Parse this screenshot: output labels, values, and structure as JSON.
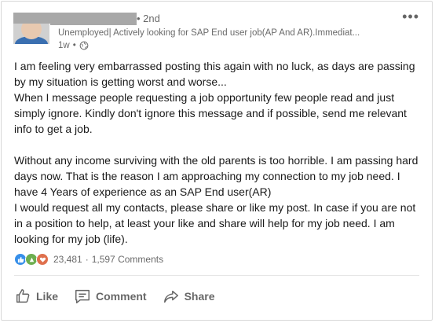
{
  "post": {
    "author": {
      "degree": "2nd",
      "headline": "Unemployed| Actively looking for SAP End user job(AP And AR).Immediat...",
      "time": "1w",
      "visibility_icon": "globe-icon"
    },
    "menu_icon": "•••",
    "body": {
      "p1": "I am feeling very embarrassed posting this again with no luck, as days are passing by my situation is getting worst and worse...",
      "p2": "When I message people requesting a job opportunity few people read and just simply ignore. Kindly don't ignore this message and if possible, send me relevant info to get a job.",
      "p3": "Without any income surviving with the old parents is too horrible. I am passing hard days now. That is the reason I am approaching my connection to my job need. I have 4 Years of experience as an SAP End user(AR)",
      "p4": "I would request all my contacts, please share or like my post. In case if you are not in a position to help, at least your like and share will help for my job need. I am looking for my job (life)."
    },
    "social": {
      "reactions": [
        "like-icon",
        "celebrate-icon",
        "love-icon"
      ],
      "reaction_count": "23,481",
      "separator": "·",
      "comments": "1,597 Comments"
    },
    "actions": {
      "like": "Like",
      "comment": "Comment",
      "share": "Share"
    }
  },
  "colors": {
    "like": "#378fe9",
    "celebrate": "#6dae4f",
    "love": "#df704d"
  }
}
